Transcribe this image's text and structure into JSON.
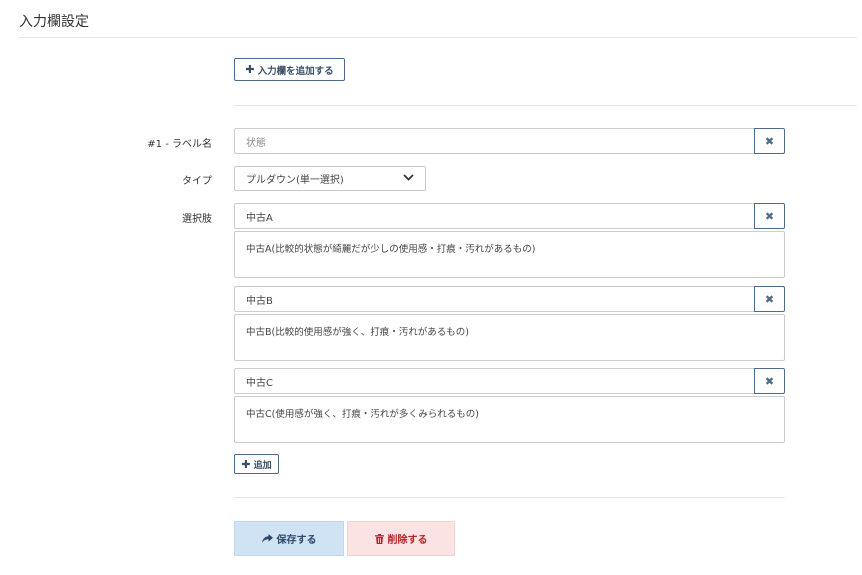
{
  "page": {
    "title": "入力欄設定"
  },
  "toolbar": {
    "add_field_label": "入力欄を追加する"
  },
  "field": {
    "label_caption": "#1 - ラベル名",
    "label_value": "状態",
    "type_caption": "タイプ",
    "type_value": "プルダウン(単一選択)",
    "options_caption": "選択肢",
    "options": [
      {
        "name": "中古A",
        "description": "中古A(比較的状態が綺麗だが少しの使用感・打痕・汚れがあるもの)"
      },
      {
        "name": "中古B",
        "description": "中古B(比較的使用感が強く、打痕・汚れがあるもの)"
      },
      {
        "name": "中古C",
        "description": "中古C(使用感が強く、打痕・汚れが多くみられるもの)"
      }
    ],
    "add_option_label": "追加"
  },
  "actions": {
    "save_label": "保存する",
    "delete_label": "削除する"
  },
  "icons": {
    "plus": "plus-icon",
    "clear": "close-icon",
    "chevron": "chevron-down-icon",
    "share": "share-arrow-icon",
    "trash": "trash-icon"
  },
  "colors": {
    "accent": "#4e6b8c",
    "save_bg": "#cfe3f5",
    "delete_bg": "#fbe3e3",
    "delete_text": "#b3262a"
  }
}
